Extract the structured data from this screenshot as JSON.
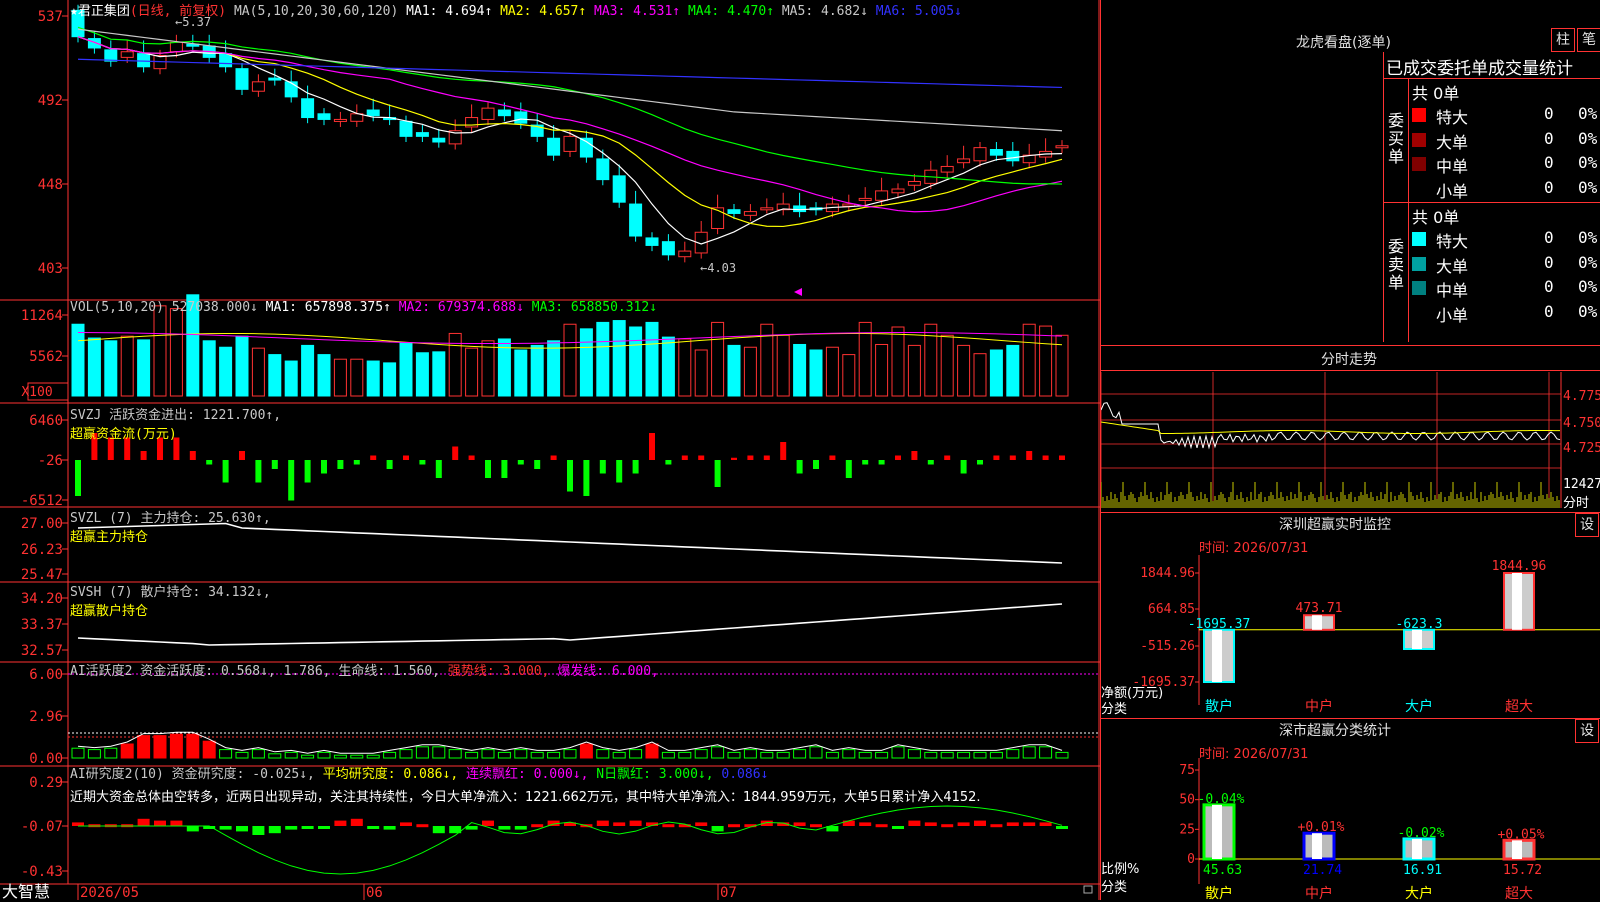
{
  "main_chart": {
    "title": "★君正集团",
    "period": "(日线, 前复权)",
    "ma_header": "MA(5,10,20,30,60,120)",
    "ma_values": [
      {
        "label": "MA1: 4.694↑",
        "color": "#ffffff"
      },
      {
        "label": "MA2: 4.657↑",
        "color": "#ffff00"
      },
      {
        "label": "MA3: 4.531↑",
        "color": "#ff00ff"
      },
      {
        "label": "MA4: 4.470↑",
        "color": "#00ff00"
      },
      {
        "label": "MA5: 4.682↓",
        "color": "#c8c8c8"
      },
      {
        "label": "MA6: 5.005↓",
        "color": "#3232ff"
      }
    ],
    "y_labels": [
      "537",
      "492",
      "448",
      "403"
    ],
    "annotation_high": "5.37",
    "annotation_low": "4.03"
  },
  "vol_pane": {
    "header": "VOL(5,10,20)",
    "values": [
      {
        "label": "527038.000↓",
        "color": "#c8c8c8"
      },
      {
        "label": "MA1: 657898.375↑",
        "color": "#ffffff"
      },
      {
        "label": "MA2: 679374.688↓",
        "color": "#ff00ff"
      },
      {
        "label": "MA3: 658850.312↓",
        "color": "#00ff00"
      }
    ],
    "y_labels": [
      "11264",
      "5562"
    ],
    "unit": "X100"
  },
  "svzj_pane": {
    "header": "SVZJ  活跃资金进出: 1221.700↑,",
    "sub": "超赢资金流(万元)",
    "y_labels": [
      "6460",
      "-26",
      "-6512"
    ]
  },
  "svzl_pane": {
    "header": "SVZL (7) 主力持仓: 25.630↑,",
    "sub": "超赢主力持仓",
    "y_labels": [
      "27.00",
      "26.23",
      "25.47"
    ]
  },
  "svsh_pane": {
    "header": "SVSH (7) 散户持仓: 34.132↓,",
    "sub": "超赢散户持仓",
    "y_labels": [
      "34.20",
      "33.37",
      "32.57"
    ]
  },
  "ai_active_pane": {
    "header_a": "AI活跃度2 资金活跃度: 0.568↓, 1.786, 生命线: 1.560,",
    "header_b": "强势线: 3.000,",
    "header_c": "爆发线: 6.000,",
    "y_labels": [
      "6.00",
      "2.96",
      "0.00"
    ]
  },
  "ai_research_pane": {
    "header_a": "AI研究度2(10) 资金研究度: -0.025↓,",
    "header_b": "平均研究度: 0.086↓,",
    "header_c": "连续飘红: 0.000↓,",
    "header_d": "N日飘红: 3.000↓,",
    "header_e": "0.086↓",
    "comment": "近期大资金总体由空转多，近两日出现异动，关注其持续性，今日大单净流入：1221.662万元，其中特大单净流入：1844.959万元，大单5日累计净入4152.",
    "y_labels": [
      "0.29",
      "-0.07",
      "-0.43"
    ]
  },
  "footer": {
    "brand": "大智慧",
    "dates": [
      "2026/05",
      "06",
      "07"
    ]
  },
  "dragon_tiger": {
    "title": "龙虎看盘(逐单)",
    "btn_zhu": "柱",
    "btn_bi": "笔",
    "subtitle": "已成交委托单成交量统计",
    "buy_label": "委买单",
    "sell_label": "委卖单",
    "buy_total": "共 0单",
    "sell_total": "共 0单",
    "buy_rows": [
      {
        "name": "特大",
        "count": "0",
        "pct": "0%",
        "color": "#ff0000"
      },
      {
        "name": "大单",
        "count": "0",
        "pct": "0%",
        "color": "#a00000"
      },
      {
        "name": "中单",
        "count": "0",
        "pct": "0%",
        "color": "#800000"
      },
      {
        "name": "小单",
        "count": "0",
        "pct": "0%",
        "color": ""
      }
    ],
    "sell_rows": [
      {
        "name": "特大",
        "count": "0",
        "pct": "0%",
        "color": "#00ffff"
      },
      {
        "name": "大单",
        "count": "0",
        "pct": "0%",
        "color": "#00a0a0"
      },
      {
        "name": "中单",
        "count": "0",
        "pct": "0%",
        "color": "#008080"
      },
      {
        "name": "小单",
        "count": "0",
        "pct": "0%",
        "color": ""
      }
    ]
  },
  "intraday": {
    "title": "分时走势",
    "price_labels": [
      "4.775",
      "4.750",
      "4.725"
    ],
    "vol_label": "12427",
    "vol_unit": "分时"
  },
  "sz_monitor": {
    "title": "深圳超赢实时监控",
    "settings": "设",
    "time": "时间: 2026/07/31",
    "y_labels": [
      "1844.96",
      "664.85",
      "-515.26",
      "-1695.37"
    ],
    "unit_a": "净额(万元)",
    "unit_b": "分类",
    "chart_data": {
      "type": "bar",
      "categories": [
        "散户",
        "中户",
        "大户",
        "超大"
      ],
      "values": [
        -1695.37,
        473.71,
        -623.3,
        1844.96
      ],
      "ylim": [
        -1695.37,
        1844.96
      ]
    }
  },
  "sz_classify": {
    "title": "深市超赢分类统计",
    "settings": "设",
    "time": "时间: 2026/07/31",
    "y_labels": [
      "75",
      "50",
      "25",
      "0"
    ],
    "unit_a": "比例%",
    "unit_b": "分类",
    "chart_data": {
      "type": "bar",
      "categories": [
        "散户",
        "中户",
        "大户",
        "超大"
      ],
      "values": [
        45.63,
        21.74,
        16.91,
        15.72
      ],
      "changes": [
        "-0.04%",
        "+0.01%",
        "-0.02%",
        "+0.05%"
      ],
      "ylim": [
        0,
        75
      ]
    }
  }
}
